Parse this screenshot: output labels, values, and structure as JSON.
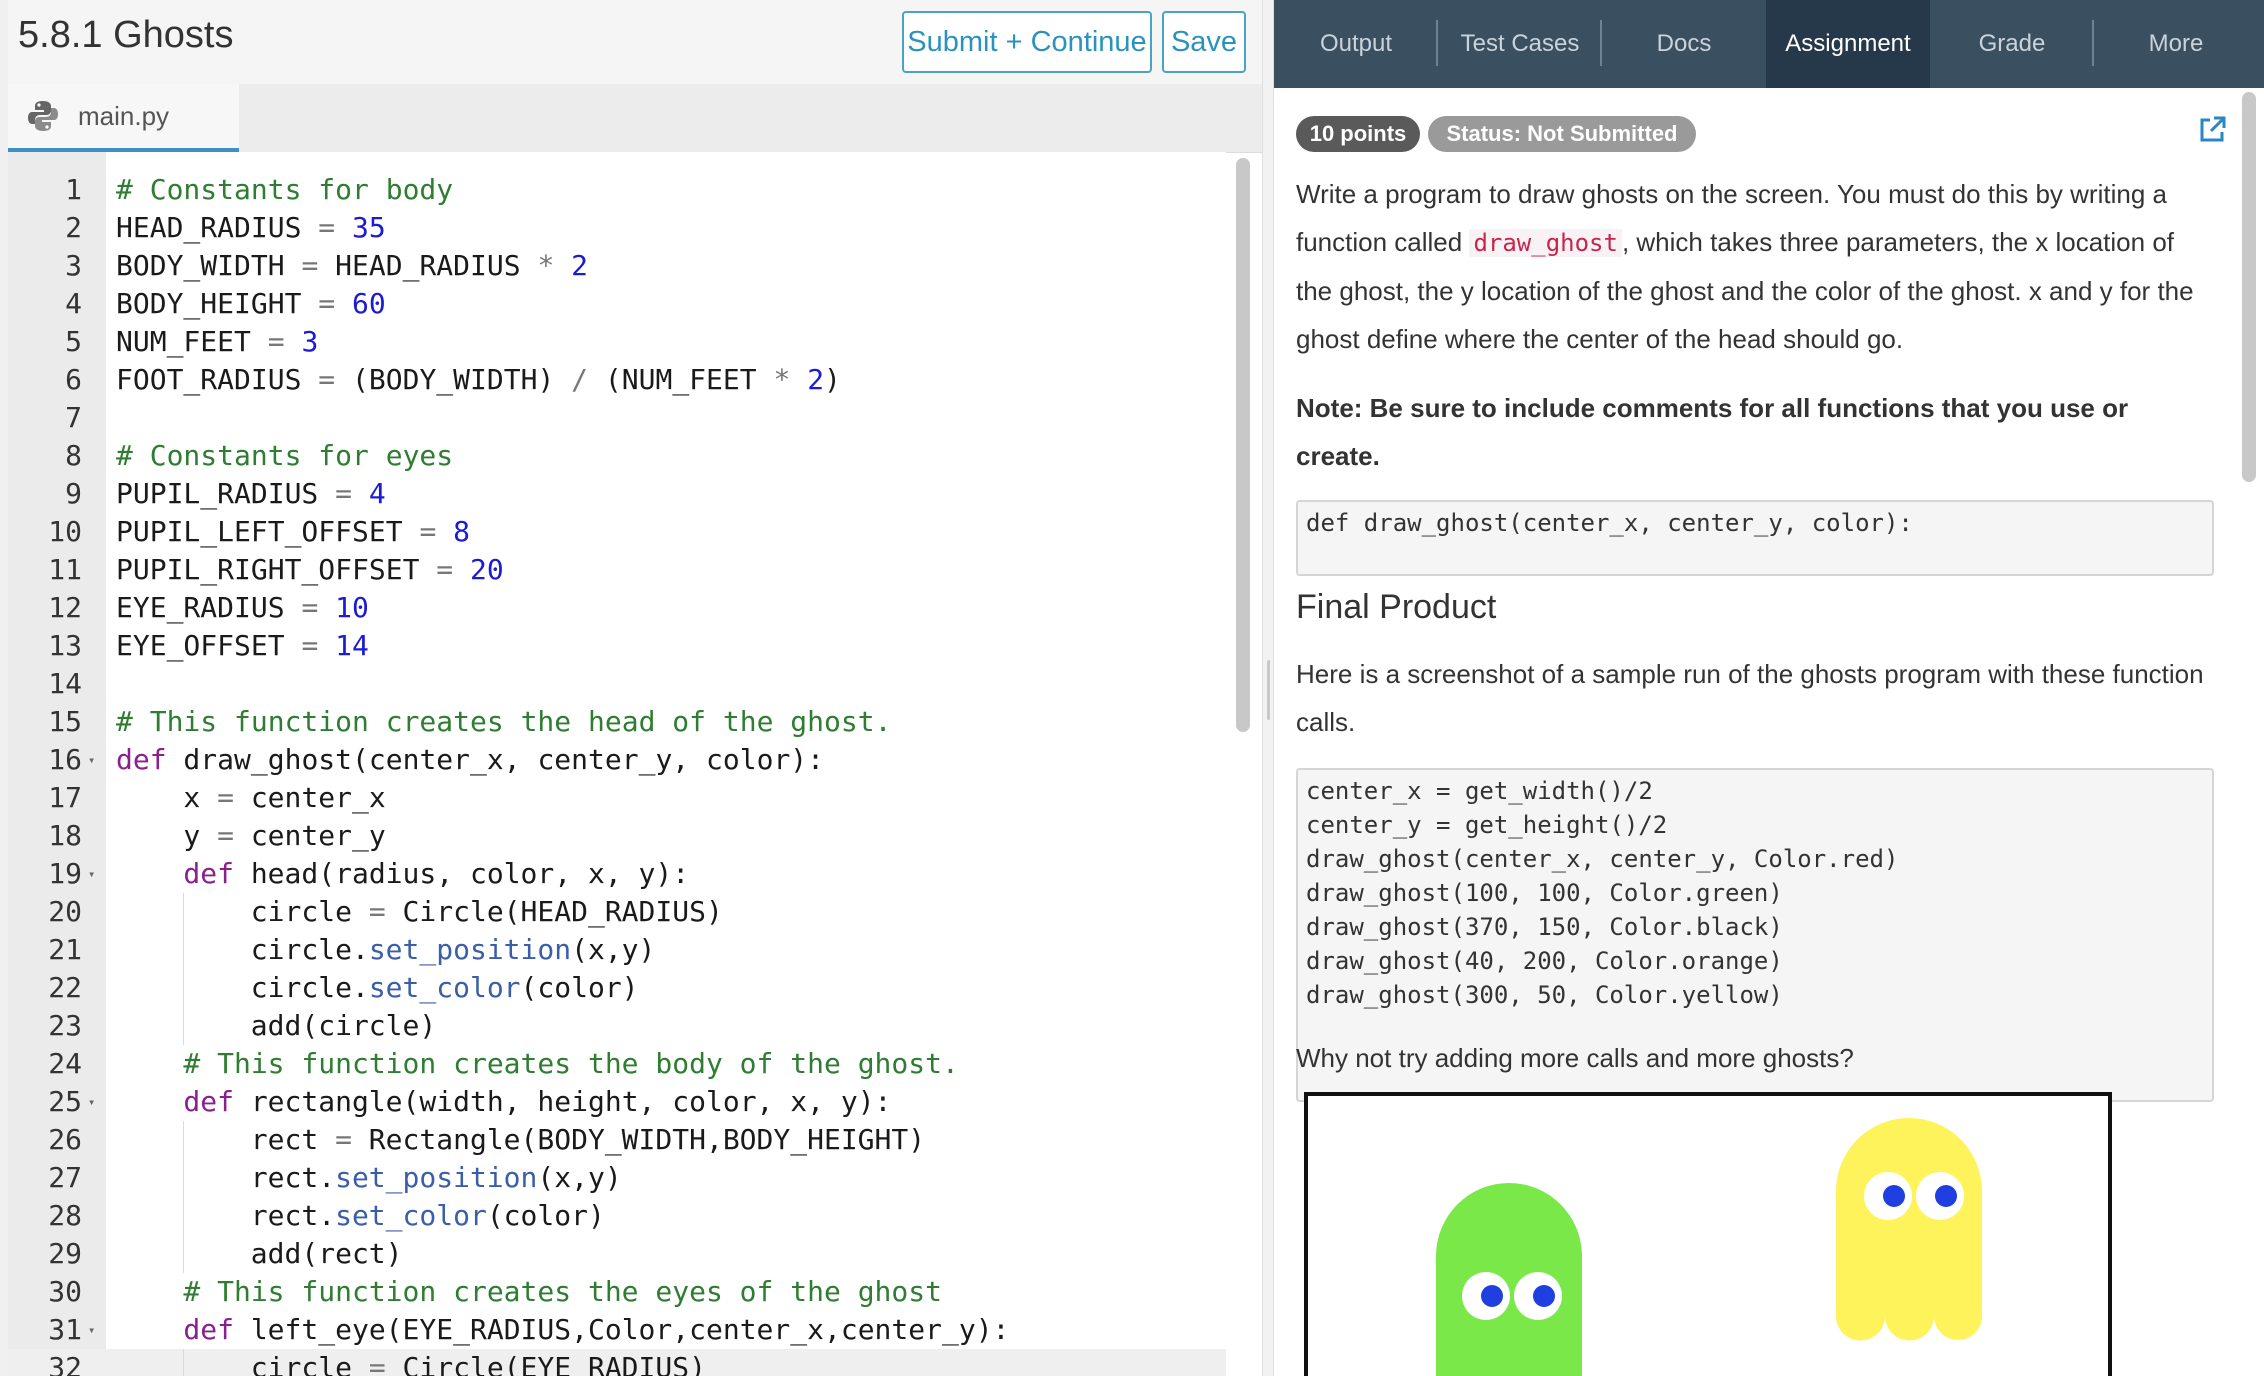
{
  "header": {
    "title": "5.8.1 Ghosts",
    "submit_label": "Submit + Continue",
    "save_label": "Save"
  },
  "file_tab": {
    "name": "main.py",
    "icon": "python-icon"
  },
  "code_lines": [
    {
      "n": "1",
      "fold": false,
      "indent": 0,
      "tokens": [
        {
          "t": "com",
          "v": "# Constants for body"
        }
      ]
    },
    {
      "n": "2",
      "fold": false,
      "indent": 0,
      "tokens": [
        {
          "t": "id",
          "v": "HEAD_RADIUS "
        },
        {
          "t": "op",
          "v": "="
        },
        {
          "t": "id",
          "v": " "
        },
        {
          "t": "num",
          "v": "35"
        }
      ]
    },
    {
      "n": "3",
      "fold": false,
      "indent": 0,
      "tokens": [
        {
          "t": "id",
          "v": "BODY_WIDTH "
        },
        {
          "t": "op",
          "v": "="
        },
        {
          "t": "id",
          "v": " HEAD_RADIUS "
        },
        {
          "t": "op",
          "v": "*"
        },
        {
          "t": "id",
          "v": " "
        },
        {
          "t": "num",
          "v": "2"
        }
      ]
    },
    {
      "n": "4",
      "fold": false,
      "indent": 0,
      "tokens": [
        {
          "t": "id",
          "v": "BODY_HEIGHT "
        },
        {
          "t": "op",
          "v": "="
        },
        {
          "t": "id",
          "v": " "
        },
        {
          "t": "num",
          "v": "60"
        }
      ]
    },
    {
      "n": "5",
      "fold": false,
      "indent": 0,
      "tokens": [
        {
          "t": "id",
          "v": "NUM_FEET "
        },
        {
          "t": "op",
          "v": "="
        },
        {
          "t": "id",
          "v": " "
        },
        {
          "t": "num",
          "v": "3"
        }
      ]
    },
    {
      "n": "6",
      "fold": false,
      "indent": 0,
      "tokens": [
        {
          "t": "id",
          "v": "FOOT_RADIUS "
        },
        {
          "t": "op",
          "v": "="
        },
        {
          "t": "id",
          "v": " (BODY_WIDTH) "
        },
        {
          "t": "op",
          "v": "/"
        },
        {
          "t": "id",
          "v": " (NUM_FEET "
        },
        {
          "t": "op",
          "v": "*"
        },
        {
          "t": "id",
          "v": " "
        },
        {
          "t": "num",
          "v": "2"
        },
        {
          "t": "id",
          "v": ")"
        }
      ]
    },
    {
      "n": "7",
      "fold": false,
      "indent": 0,
      "tokens": []
    },
    {
      "n": "8",
      "fold": false,
      "indent": 0,
      "tokens": [
        {
          "t": "com",
          "v": "# Constants for eyes"
        }
      ]
    },
    {
      "n": "9",
      "fold": false,
      "indent": 0,
      "tokens": [
        {
          "t": "id",
          "v": "PUPIL_RADIUS "
        },
        {
          "t": "op",
          "v": "="
        },
        {
          "t": "id",
          "v": " "
        },
        {
          "t": "num",
          "v": "4"
        }
      ]
    },
    {
      "n": "10",
      "fold": false,
      "indent": 0,
      "tokens": [
        {
          "t": "id",
          "v": "PUPIL_LEFT_OFFSET "
        },
        {
          "t": "op",
          "v": "="
        },
        {
          "t": "id",
          "v": " "
        },
        {
          "t": "num",
          "v": "8"
        }
      ]
    },
    {
      "n": "11",
      "fold": false,
      "indent": 0,
      "tokens": [
        {
          "t": "id",
          "v": "PUPIL_RIGHT_OFFSET "
        },
        {
          "t": "op",
          "v": "="
        },
        {
          "t": "id",
          "v": " "
        },
        {
          "t": "num",
          "v": "20"
        }
      ]
    },
    {
      "n": "12",
      "fold": false,
      "indent": 0,
      "tokens": [
        {
          "t": "id",
          "v": "EYE_RADIUS "
        },
        {
          "t": "op",
          "v": "="
        },
        {
          "t": "id",
          "v": " "
        },
        {
          "t": "num",
          "v": "10"
        }
      ]
    },
    {
      "n": "13",
      "fold": false,
      "indent": 0,
      "tokens": [
        {
          "t": "id",
          "v": "EYE_OFFSET "
        },
        {
          "t": "op",
          "v": "="
        },
        {
          "t": "id",
          "v": " "
        },
        {
          "t": "num",
          "v": "14"
        }
      ]
    },
    {
      "n": "14",
      "fold": false,
      "indent": 0,
      "tokens": []
    },
    {
      "n": "15",
      "fold": false,
      "indent": 0,
      "tokens": [
        {
          "t": "com",
          "v": "# This function creates the head of the ghost."
        }
      ]
    },
    {
      "n": "16",
      "fold": true,
      "indent": 0,
      "tokens": [
        {
          "t": "kw",
          "v": "def"
        },
        {
          "t": "id",
          "v": " draw_ghost(center_x, center_y, color):"
        }
      ]
    },
    {
      "n": "17",
      "fold": false,
      "indent": 1,
      "tokens": [
        {
          "t": "id",
          "v": "x "
        },
        {
          "t": "op",
          "v": "="
        },
        {
          "t": "id",
          "v": " center_x"
        }
      ]
    },
    {
      "n": "18",
      "fold": false,
      "indent": 1,
      "tokens": [
        {
          "t": "id",
          "v": "y "
        },
        {
          "t": "op",
          "v": "="
        },
        {
          "t": "id",
          "v": " center_y"
        }
      ]
    },
    {
      "n": "19",
      "fold": true,
      "indent": 1,
      "tokens": [
        {
          "t": "kw",
          "v": "def"
        },
        {
          "t": "id",
          "v": " head(radius, color, x, y):"
        }
      ]
    },
    {
      "n": "20",
      "fold": false,
      "indent": 2,
      "tokens": [
        {
          "t": "id",
          "v": "circle "
        },
        {
          "t": "op",
          "v": "="
        },
        {
          "t": "id",
          "v": " Circle(HEAD_RADIUS)"
        }
      ]
    },
    {
      "n": "21",
      "fold": false,
      "indent": 2,
      "tokens": [
        {
          "t": "id",
          "v": "circle."
        },
        {
          "t": "meth",
          "v": "set_position"
        },
        {
          "t": "id",
          "v": "(x,y)"
        }
      ]
    },
    {
      "n": "22",
      "fold": false,
      "indent": 2,
      "tokens": [
        {
          "t": "id",
          "v": "circle."
        },
        {
          "t": "meth",
          "v": "set_color"
        },
        {
          "t": "id",
          "v": "(color)"
        }
      ]
    },
    {
      "n": "23",
      "fold": false,
      "indent": 2,
      "tokens": [
        {
          "t": "id",
          "v": "add(circle)"
        }
      ]
    },
    {
      "n": "24",
      "fold": false,
      "indent": 1,
      "tokens": [
        {
          "t": "com",
          "v": "# This function creates the body of the ghost."
        }
      ]
    },
    {
      "n": "25",
      "fold": true,
      "indent": 1,
      "tokens": [
        {
          "t": "kw",
          "v": "def"
        },
        {
          "t": "id",
          "v": " rectangle(width, height, color, x, y):"
        }
      ]
    },
    {
      "n": "26",
      "fold": false,
      "indent": 2,
      "tokens": [
        {
          "t": "id",
          "v": "rect "
        },
        {
          "t": "op",
          "v": "="
        },
        {
          "t": "id",
          "v": " Rectangle(BODY_WIDTH,BODY_HEIGHT)"
        }
      ]
    },
    {
      "n": "27",
      "fold": false,
      "indent": 2,
      "tokens": [
        {
          "t": "id",
          "v": "rect."
        },
        {
          "t": "meth",
          "v": "set_position"
        },
        {
          "t": "id",
          "v": "(x,y)"
        }
      ]
    },
    {
      "n": "28",
      "fold": false,
      "indent": 2,
      "tokens": [
        {
          "t": "id",
          "v": "rect."
        },
        {
          "t": "meth",
          "v": "set_color"
        },
        {
          "t": "id",
          "v": "(color)"
        }
      ]
    },
    {
      "n": "29",
      "fold": false,
      "indent": 2,
      "tokens": [
        {
          "t": "id",
          "v": "add(rect)"
        }
      ]
    },
    {
      "n": "30",
      "fold": false,
      "indent": 1,
      "tokens": [
        {
          "t": "com",
          "v": "# This function creates the eyes of the ghost"
        }
      ]
    },
    {
      "n": "31",
      "fold": true,
      "indent": 1,
      "tokens": [
        {
          "t": "kw",
          "v": "def"
        },
        {
          "t": "id",
          "v": " left_eye(EYE_RADIUS,Color,center_x,center_y):"
        }
      ]
    },
    {
      "n": "32",
      "fold": false,
      "indent": 2,
      "active": true,
      "tokens": [
        {
          "t": "id",
          "v": "circle "
        },
        {
          "t": "op",
          "v": "="
        },
        {
          "t": "id",
          "v": " Circle(EYE_RADIUS)"
        }
      ]
    }
  ],
  "right_tabs": [
    {
      "label": "Output",
      "active": false
    },
    {
      "label": "Test Cases",
      "active": false
    },
    {
      "label": "Docs",
      "active": false
    },
    {
      "label": "Assignment",
      "active": true
    },
    {
      "label": "Grade",
      "active": false
    },
    {
      "label": "More",
      "active": false
    }
  ],
  "assignment": {
    "points_badge": "10 points",
    "status_badge": "Status: Not Submitted",
    "intro_before": "Write a program to draw ghosts on the screen. You must do this by writing a function called ",
    "intro_code": "draw_ghost",
    "intro_after": ", which takes three parameters, the x location of the ghost, the y location of the ghost and the color of the ghost. x and y for the ghost define where the center of the head should go.",
    "note": "Note: Be sure to include comments for all functions that you use or create.",
    "signature": "def draw_ghost(center_x, center_y, color):",
    "final_heading": "Final Product",
    "screenshot_text": "Here is a screenshot of a sample run of the ghosts program with these function calls.",
    "sample_calls": [
      "center_x = get_width()/2",
      "center_y = get_height()/2",
      "draw_ghost(center_x, center_y, Color.red)",
      "draw_ghost(100, 100, Color.green)",
      "draw_ghost(370, 150, Color.black)",
      "draw_ghost(40, 200, Color.orange)",
      "draw_ghost(300, 50, Color.yellow)"
    ],
    "why_text": "Why not try adding more calls and more ghosts?"
  },
  "colors": {
    "nav_bg": "#3a4f60",
    "nav_active": "#26394a",
    "accent": "#2a93bd",
    "ghost_green": "#7be84a",
    "ghost_yellow": "#fff35c",
    "pupil": "#1f3fe0"
  }
}
